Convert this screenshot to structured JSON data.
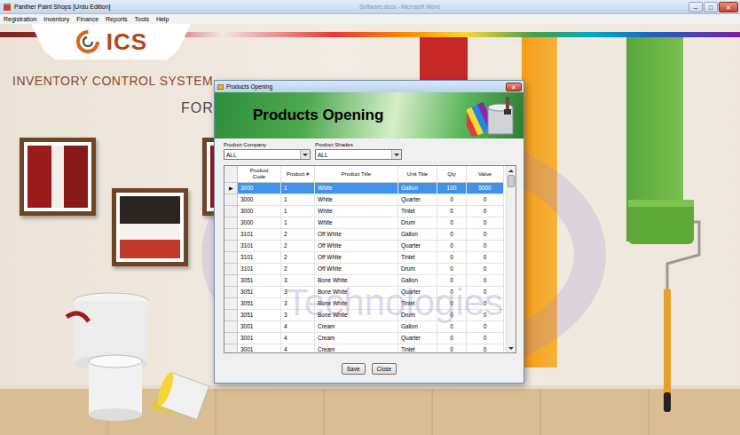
{
  "window": {
    "title": "Panther Paint Shops [Urdu Edition]",
    "background_title": "Software.docx - Microsoft Word",
    "controls": [
      "–",
      "□",
      "✕"
    ]
  },
  "menu": [
    "Registration",
    "Inventory",
    "Finance",
    "Reports",
    "Tools",
    "Help"
  ],
  "splash": {
    "logo": "ICS",
    "heading": "INVENTORY CONTROL SYSTEM",
    "subheading": "FOR",
    "watermark": "Technologies"
  },
  "dialog": {
    "title": "Products Opening",
    "close": "✕",
    "banner": "Products Opening",
    "filters": [
      {
        "label": "Product Company",
        "value": "ALL"
      },
      {
        "label": "Product Shades",
        "value": "ALL"
      }
    ],
    "table": {
      "columns": [
        "Product Code",
        "Product #",
        "Product Title",
        "Unit Title",
        "Qty",
        "Value"
      ],
      "current_row_marker": "▶",
      "rows": [
        {
          "cells": [
            "3000",
            "1",
            "White",
            "Gallon",
            "100",
            "5000"
          ],
          "selected": true
        },
        {
          "cells": [
            "3000",
            "1",
            "White",
            "Quarter",
            "0",
            "0"
          ],
          "selected": false
        },
        {
          "cells": [
            "3000",
            "1",
            "White",
            "Tinlet",
            "0",
            "0"
          ],
          "selected": false
        },
        {
          "cells": [
            "3000",
            "1",
            "White",
            "Drum",
            "0",
            "0"
          ],
          "selected": false
        },
        {
          "cells": [
            "3101",
            "2",
            "Off White",
            "Gallon",
            "0",
            "0"
          ],
          "selected": false
        },
        {
          "cells": [
            "3101",
            "2",
            "Off White",
            "Quarter",
            "0",
            "0"
          ],
          "selected": false
        },
        {
          "cells": [
            "3101",
            "2",
            "Off White",
            "Tinlet",
            "0",
            "0"
          ],
          "selected": false
        },
        {
          "cells": [
            "3101",
            "2",
            "Off White",
            "Drum",
            "0",
            "0"
          ],
          "selected": false
        },
        {
          "cells": [
            "3051",
            "3",
            "Bone White",
            "Gallon",
            "0",
            "0"
          ],
          "selected": false
        },
        {
          "cells": [
            "3051",
            "3",
            "Bone White",
            "Quarter",
            "0",
            "0"
          ],
          "selected": false
        },
        {
          "cells": [
            "3051",
            "3",
            "Bone White",
            "Tinlet",
            "0",
            "0"
          ],
          "selected": false
        },
        {
          "cells": [
            "3051",
            "3",
            "Bone White",
            "Drum",
            "0",
            "0"
          ],
          "selected": false
        },
        {
          "cells": [
            "3001",
            "4",
            "Cream",
            "Gallon",
            "0",
            "0"
          ],
          "selected": false
        },
        {
          "cells": [
            "3001",
            "4",
            "Cream",
            "Quarter",
            "0",
            "0"
          ],
          "selected": false
        },
        {
          "cells": [
            "3001",
            "4",
            "Cream",
            "Tinlet",
            "0",
            "0"
          ],
          "selected": false
        }
      ]
    },
    "buttons": [
      "Save",
      "Close"
    ]
  }
}
